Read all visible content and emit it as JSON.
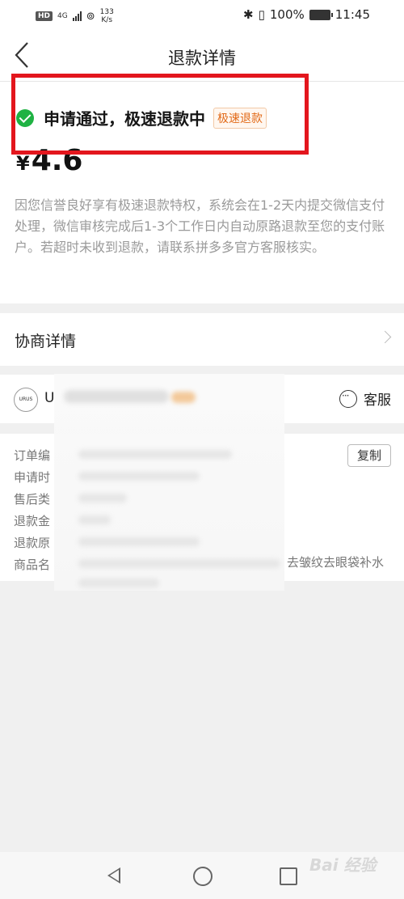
{
  "status_bar": {
    "hd": "HD",
    "net": "4G",
    "speed": "133",
    "speed_unit": "K/s",
    "battery": "100%",
    "time": "11:45"
  },
  "header": {
    "title": "退款详情"
  },
  "refund": {
    "status": "申请通过，极速退款中",
    "badge": "极速退款",
    "currency": "¥",
    "amount": "4.6",
    "description": "因您信誉良好享有极速退款特权，系统会在1-2天内提交微信支付处理，微信审核完成后1-3个工作日内自动原路退款至您的支付账户。若超时未收到退款，请联系拼多多官方客服核实。"
  },
  "negotiation": {
    "label": "协商详情"
  },
  "merchant": {
    "logo_text": "URUS",
    "name": "U",
    "service_label": "客服"
  },
  "order_info": {
    "rows": [
      "订单编",
      "申请时",
      "售后类",
      "退款金",
      "退款原",
      "商品名"
    ],
    "copy_label": "复制",
    "product_tail": "去皱纹去眼袋补水"
  },
  "colors": {
    "accent_orange": "#e26a18",
    "success_green": "#1fb243",
    "highlight_red": "#e3161d"
  },
  "watermark": "Bai 经验"
}
